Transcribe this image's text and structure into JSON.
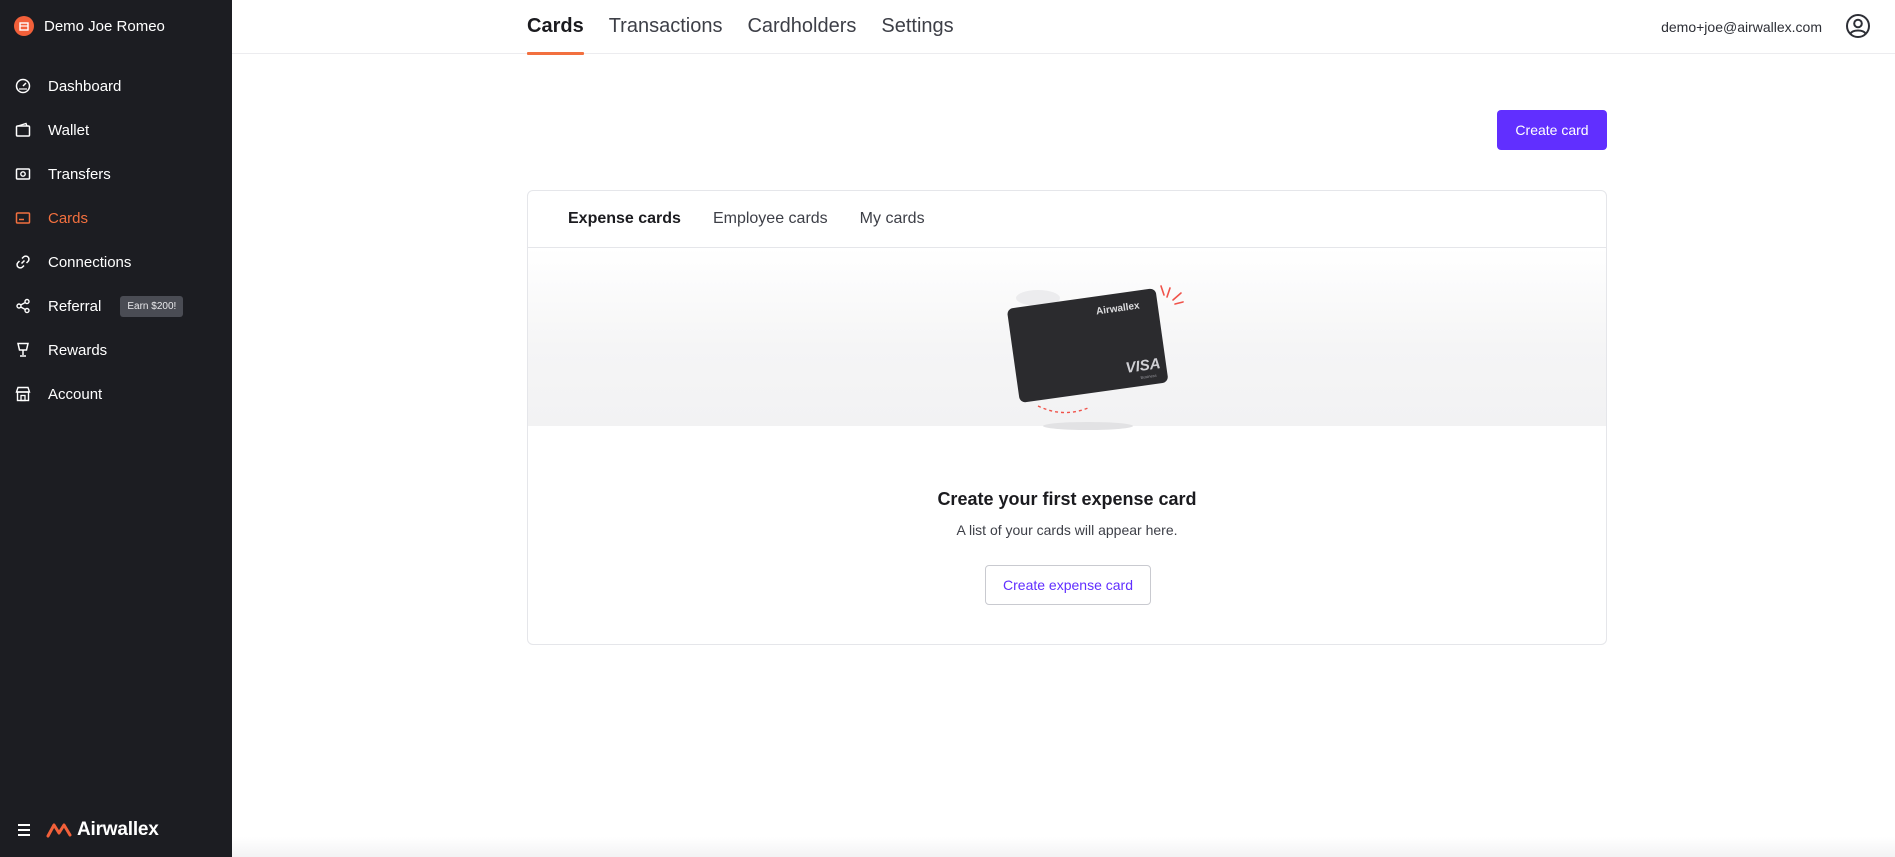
{
  "account": {
    "name": "Demo Joe Romeo"
  },
  "sidebar": {
    "items": [
      {
        "label": "Dashboard",
        "icon": "dashboard-icon"
      },
      {
        "label": "Wallet",
        "icon": "wallet-icon"
      },
      {
        "label": "Transfers",
        "icon": "transfers-icon"
      },
      {
        "label": "Cards",
        "icon": "cards-icon",
        "active": true
      },
      {
        "label": "Connections",
        "icon": "link-icon"
      },
      {
        "label": "Referral",
        "icon": "share-icon",
        "badge": "Earn $200!"
      },
      {
        "label": "Rewards",
        "icon": "trophy-icon"
      },
      {
        "label": "Account",
        "icon": "building-icon"
      }
    ],
    "logo_text": "Airwallex"
  },
  "header": {
    "tabs": [
      "Cards",
      "Transactions",
      "Cardholders",
      "Settings"
    ],
    "active_tab": "Cards",
    "user_email": "demo+joe@airwallex.com"
  },
  "main": {
    "create_card_label": "Create card",
    "subtabs": [
      "Expense cards",
      "Employee cards",
      "My cards"
    ],
    "active_subtab": "Expense cards",
    "card_illustration": {
      "brand_text": "Airwallex",
      "network_text": "VISA",
      "network_sub": "Business"
    },
    "empty_title": "Create your first expense card",
    "empty_subtitle": "A list of your cards will appear here.",
    "create_expense_label": "Create expense card"
  },
  "colors": {
    "sidebar_bg": "#1c1d22",
    "accent_orange": "#f2703f",
    "primary_purple": "#612fff"
  }
}
